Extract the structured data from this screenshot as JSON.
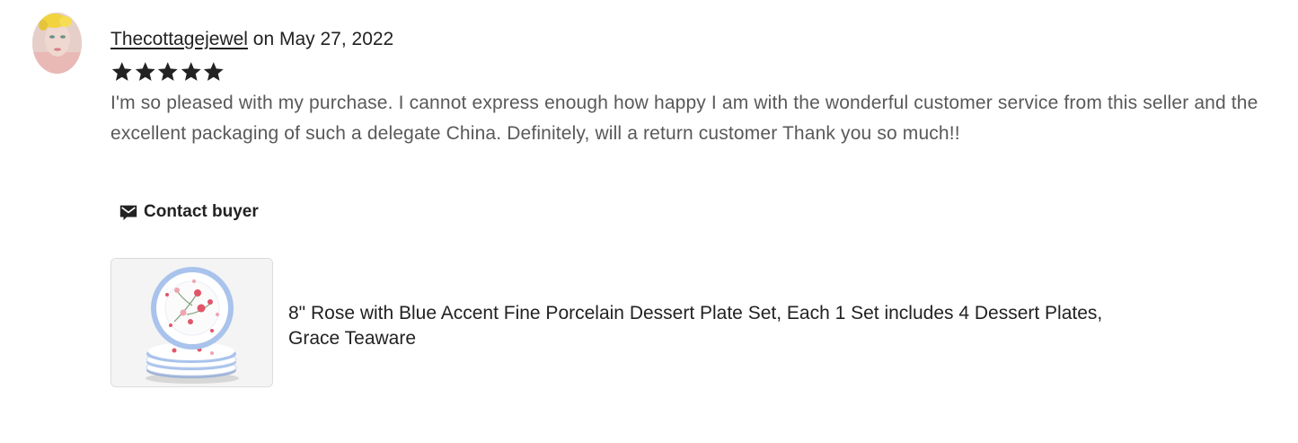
{
  "review": {
    "author": "Thecottagejewel",
    "date_prefix": "on",
    "date": "May 27, 2022",
    "rating": 5,
    "text": "I'm so pleased with my purchase. I cannot express enough how happy I am with the wonderful customer service from this seller and the excellent packaging of such a delegate China. Definitely, will a return customer Thank you so much!!"
  },
  "contact": {
    "label": "Contact buyer",
    "icon": "envelope-icon"
  },
  "product": {
    "title": "8\" Rose with Blue Accent Fine Porcelain Dessert Plate Set, Each 1 Set includes 4 Dessert Plates, Grace Teaware"
  },
  "colors": {
    "star": "#222222",
    "review_text": "#595959",
    "thumb_bg": "#f4f4f4",
    "plate_rim": "#a9c3ec"
  }
}
